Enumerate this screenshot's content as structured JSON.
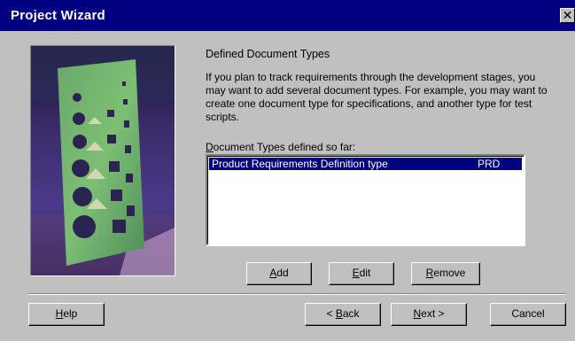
{
  "window": {
    "title": "Project Wizard",
    "close_glyph": "✕"
  },
  "image": {
    "description_icon": "hardware-stencil-photo"
  },
  "page": {
    "heading": "Defined Document Types",
    "description": "If you plan to track requirements through the development stages, you may want to add several document types.  For example, you may want to create one document type for specifications, and another type for test scripts.",
    "list_label_accel": "D",
    "list_label_rest": "ocument Types defined so far:"
  },
  "list": {
    "items": [
      {
        "name": "Product Requirements Definition type",
        "code": "PRD",
        "selected": true
      }
    ]
  },
  "buttons": {
    "add": {
      "accel": "A",
      "rest": "dd"
    },
    "edit": {
      "accel": "E",
      "rest": "dit"
    },
    "remove": {
      "accel": "R",
      "rest": "emove"
    },
    "help": {
      "accel": "H",
      "rest": "elp"
    },
    "back": {
      "pre": "< ",
      "accel": "B",
      "rest": "ack"
    },
    "next": {
      "accel": "N",
      "rest": "ext >"
    },
    "cancel": {
      "label": "Cancel"
    }
  },
  "colors": {
    "title_bar": "#000080",
    "selection": "#000080",
    "face": "#c0c0c0"
  }
}
